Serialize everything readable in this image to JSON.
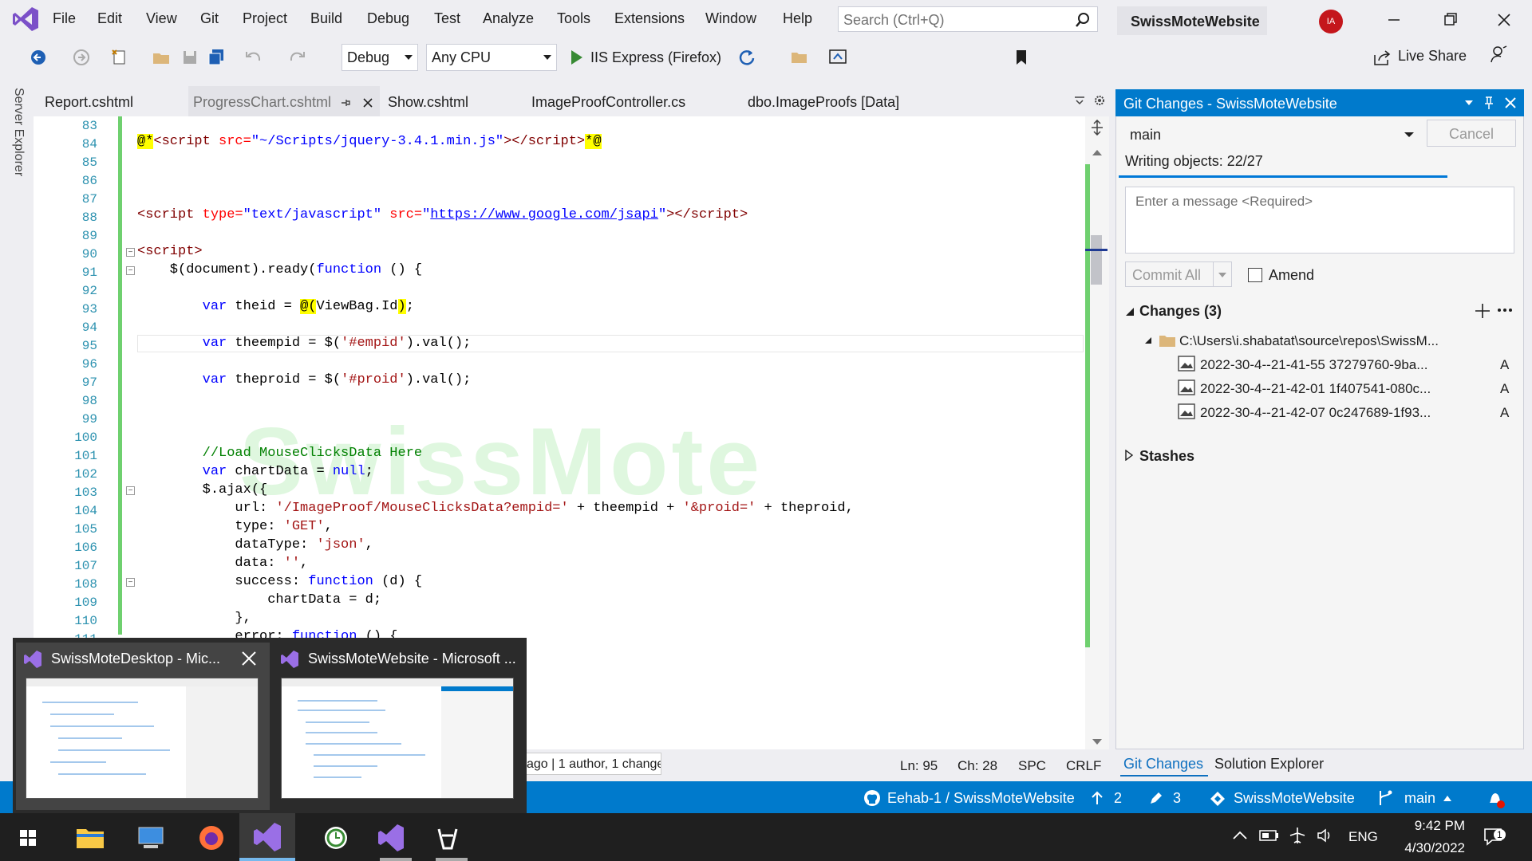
{
  "menu": [
    "File",
    "Edit",
    "View",
    "Git",
    "Project",
    "Build",
    "Debug",
    "Test",
    "Analyze",
    "Tools",
    "Extensions",
    "Window",
    "Help"
  ],
  "search": {
    "placeholder": "Search (Ctrl+Q)"
  },
  "solution_name": "SwissMoteWebsite",
  "avatar": "IA",
  "toolbar": {
    "config": "Debug",
    "platform": "Any CPU",
    "run_target": "IIS Express (Firefox)",
    "live_share": "Live Share"
  },
  "server_explorer": "Server Explorer",
  "tabs": [
    "Report.cshtml",
    "ProgressChart.cshtml",
    "Show.cshtml",
    "ImageProofController.cs",
    "dbo.ImageProofs [Data]"
  ],
  "line_numbers": [
    "83",
    "84",
    "85",
    "86",
    "87",
    "88",
    "89",
    "90",
    "91",
    "92",
    "93",
    "94",
    "95",
    "96",
    "97",
    "98",
    "99",
    "100",
    "101",
    "102",
    "103",
    "104",
    "105",
    "106",
    "107",
    "108",
    "109",
    "110",
    "111"
  ],
  "watermark": "SwissMote",
  "editor_status": {
    "blame": "ago | 1 author, 1 change",
    "ln": "Ln: 95",
    "ch": "Ch: 28",
    "spc": "SPC",
    "crlf": "CRLF"
  },
  "git": {
    "title": "Git Changes - SwissMoteWebsite",
    "branch": "main",
    "cancel": "Cancel",
    "writing": "Writing objects: 22/27",
    "message_placeholder": "Enter a message <Required>",
    "commit_all": "Commit All",
    "amend": "Amend",
    "changes": "Changes (3)",
    "folder": "C:\\Users\\i.shabatat\\source\\repos\\SwissM...",
    "files": [
      {
        "name": "2022-30-4--21-41-55 37279760-9ba...",
        "status": "A"
      },
      {
        "name": "2022-30-4--21-42-01 1f407541-080c...",
        "status": "A"
      },
      {
        "name": "2022-30-4--21-42-07 0c247689-1f93...",
        "status": "A"
      }
    ],
    "stashes": "Stashes",
    "tab_git": "Git Changes",
    "tab_solution": "Solution Explorer"
  },
  "statusbar": {
    "repo": "Eehab-1 / SwissMoteWebsite",
    "up": "2",
    "edits": "3",
    "solution": "SwissMoteWebsite",
    "branch": "main"
  },
  "thumbs": [
    {
      "title": "SwissMoteDesktop - Mic..."
    },
    {
      "title": "SwissMoteWebsite - Microsoft ..."
    }
  ],
  "tray": {
    "lang": "ENG",
    "time": "9:42 PM",
    "date": "4/30/2022",
    "notif": "1"
  }
}
